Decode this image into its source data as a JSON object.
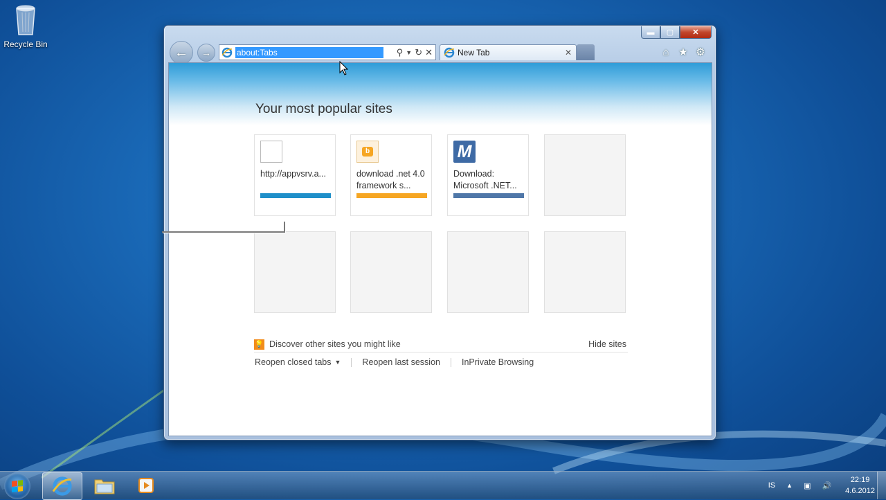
{
  "desktop": {
    "recycle_bin_label": "Recycle Bin"
  },
  "browser": {
    "address_value": "about:Tabs",
    "tab_title": "New Tab",
    "page_heading": "Your most popular sites",
    "tiles": [
      {
        "label": "http://appvsrv.a...",
        "bar_color": "#1f8fc9"
      },
      {
        "label": "download .net 4.0 framework s...",
        "bar_color": "#f6a623"
      },
      {
        "label": "Download: Microsoft .NET...",
        "bar_color": "#4f77a8"
      }
    ],
    "discover_label": "Discover other sites you might like",
    "hide_sites_label": "Hide sites",
    "reopen_closed_tabs_label": "Reopen closed tabs",
    "reopen_last_session_label": "Reopen last session",
    "inprivate_label": "InPrivate Browsing"
  },
  "taskbar": {
    "language": "IS",
    "time": "22:19",
    "date": "4.6.2012"
  },
  "colors": {
    "accent_blue": "#1f8fc9",
    "accent_orange": "#f6a623",
    "accent_slate": "#4f77a8"
  }
}
